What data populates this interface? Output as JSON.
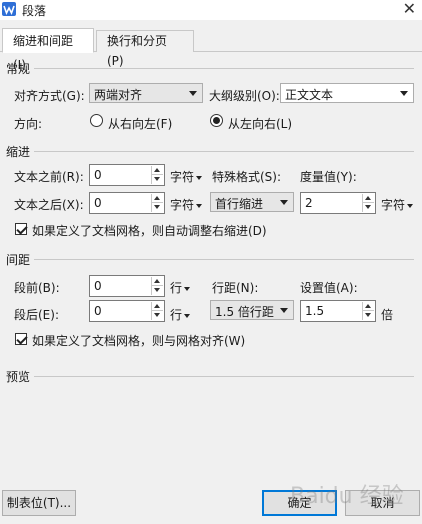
{
  "window": {
    "title": "段落",
    "icon": "wps-writer-icon",
    "close_label": "✕"
  },
  "tabs": [
    {
      "label": "缩进和间距(I)",
      "active": true
    },
    {
      "label": "换行和分页(P)",
      "active": false
    }
  ],
  "general": {
    "heading": "常规",
    "alignment_label": "对齐方式(G):",
    "alignment_value": "两端对齐",
    "outline_label": "大纲级别(O):",
    "outline_value": "正文文本",
    "direction_label": "方向:",
    "rtl_label": "从右向左(F)",
    "ltr_label": "从左向右(L)",
    "direction_selected": "ltr"
  },
  "indent": {
    "heading": "缩进",
    "before_label": "文本之前(R):",
    "before_value": "0",
    "before_unit": "字符",
    "after_label": "文本之后(X):",
    "after_value": "0",
    "after_unit": "字符",
    "special_label": "特殊格式(S):",
    "special_value": "首行缩进",
    "measure_label": "度量值(Y):",
    "measure_value": "2",
    "measure_unit": "字符",
    "grid_checkbox_label": "如果定义了文档网格，则自动调整右缩进(D)",
    "grid_checkbox_checked": true
  },
  "spacing": {
    "heading": "间距",
    "before_label": "段前(B):",
    "before_value": "0",
    "before_unit": "行",
    "after_label": "段后(E):",
    "after_value": "0",
    "after_unit": "行",
    "line_label": "行距(N):",
    "line_value": "1.5 倍行距",
    "setting_label": "设置值(A):",
    "setting_value": "1.5",
    "setting_unit": "倍",
    "grid_checkbox_label": "如果定义了文档网格，则与网格对齐(W)",
    "grid_checkbox_checked": true
  },
  "preview": {
    "heading": "预览"
  },
  "footer": {
    "tabs_button": "制表位(T)...",
    "ok_button": "确定",
    "cancel_button": "取消"
  },
  "watermark": "Baidu 经验"
}
